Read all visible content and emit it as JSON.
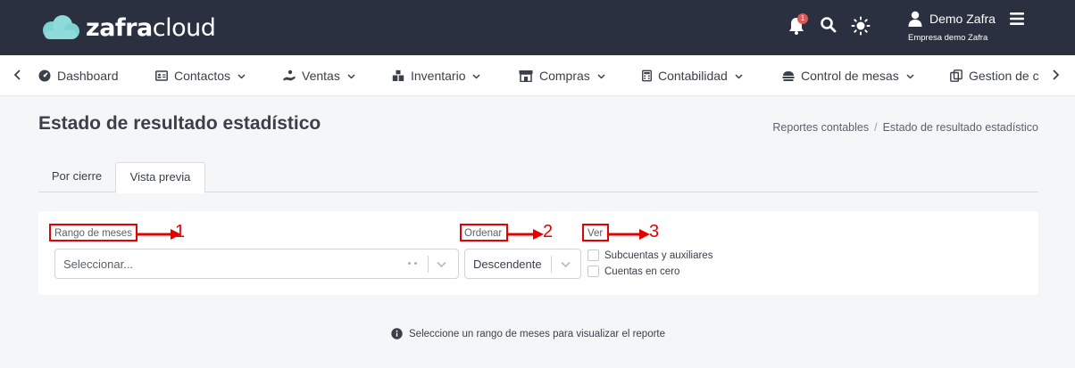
{
  "app": {
    "logo_part1": "zafra",
    "logo_part2": "cloud",
    "notification_count": "1",
    "user_name": "Demo Zafra",
    "company": "Empresa demo Zafra"
  },
  "nav": {
    "items": [
      {
        "label": "Dashboard",
        "icon": "dashboard-icon"
      },
      {
        "label": "Contactos",
        "icon": "contacts-icon"
      },
      {
        "label": "Ventas",
        "icon": "sales-icon"
      },
      {
        "label": "Inventario",
        "icon": "inventory-icon"
      },
      {
        "label": "Compras",
        "icon": "store-icon"
      },
      {
        "label": "Contabilidad",
        "icon": "calculator-icon"
      },
      {
        "label": "Control de mesas",
        "icon": "table-control-icon"
      },
      {
        "label": "Gestion de c",
        "icon": "copy-icon"
      }
    ]
  },
  "page": {
    "title": "Estado de resultado estadístico",
    "breadcrumb": [
      "Reportes contables",
      "Estado de resultado estadístico"
    ],
    "breadcrumb_sep": "/"
  },
  "tabs": [
    {
      "label": "Por cierre",
      "active": false
    },
    {
      "label": "Vista previa",
      "active": true
    }
  ],
  "filters": {
    "range_label": "Rango de meses",
    "range_placeholder": "Seleccionar...",
    "order_label": "Ordenar",
    "order_value": "Descendente",
    "view_label": "Ver",
    "view_options": [
      "Subcuentas y auxiliares",
      "Cuentas en cero"
    ]
  },
  "annotations": [
    "1",
    "2",
    "3"
  ],
  "annotation_color": "#e60000",
  "info_message": "Seleccione un rango de meses para visualizar el reporte",
  "colors": {
    "topbar": "#2b3040",
    "logo_cloud": "#7fd3d3",
    "badge": "#e05555"
  }
}
